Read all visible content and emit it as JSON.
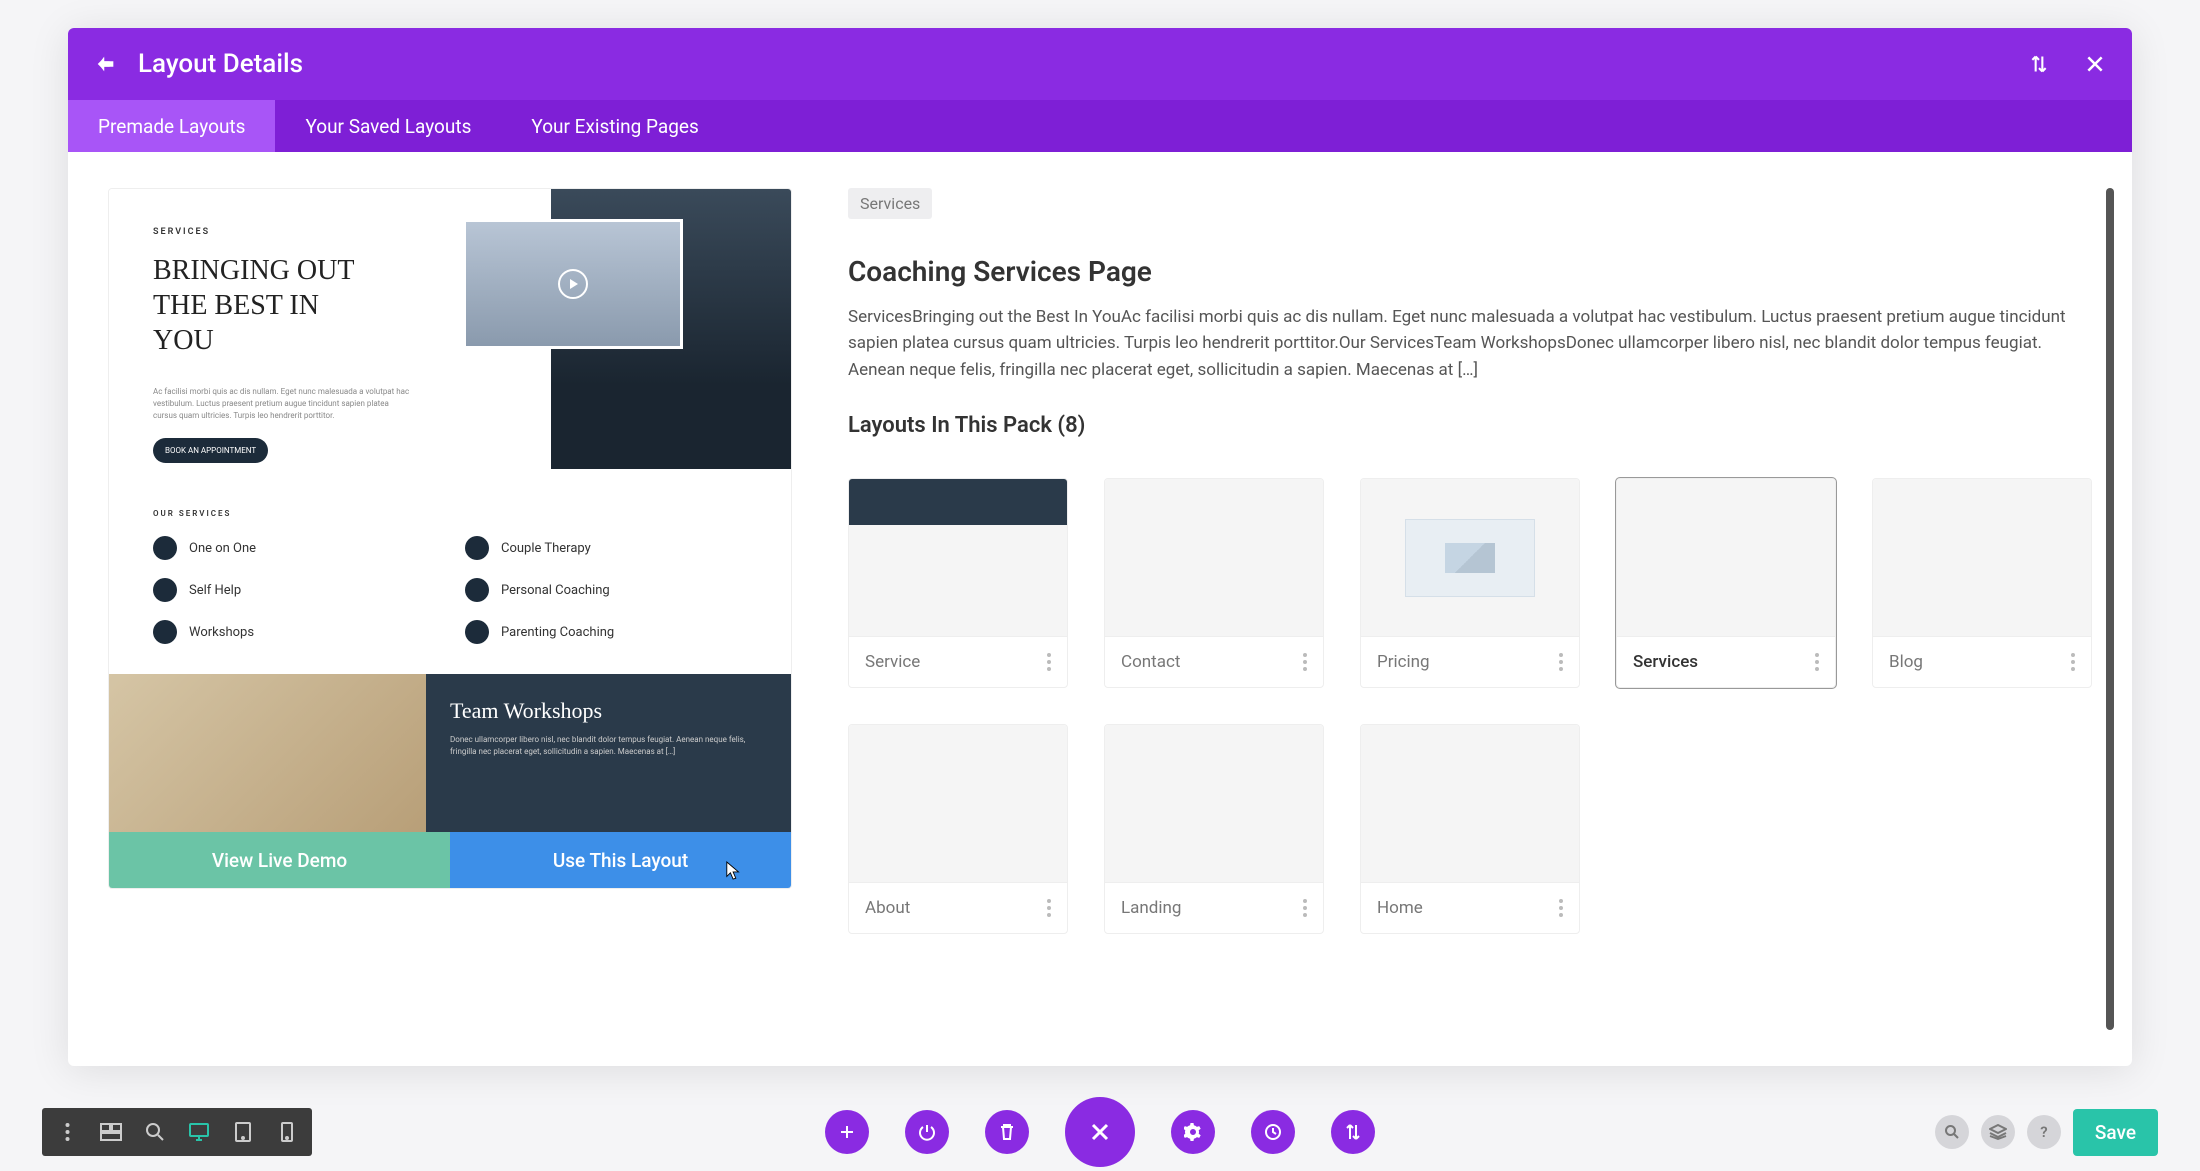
{
  "header": {
    "title": "Layout Details"
  },
  "tabs": [
    {
      "label": "Premade Layouts",
      "active": true
    },
    {
      "label": "Your Saved Layouts",
      "active": false
    },
    {
      "label": "Your Existing Pages",
      "active": false
    }
  ],
  "preview": {
    "hero_tag": "SERVICES",
    "hero_title": "BRINGING OUT THE BEST IN YOU",
    "hero_lorem": "Ac facilisi morbi quis ac dis nullam. Eget nunc malesuada a volutpat hac vestibulum. Luctus praesent pretium augue tincidunt sapien platea cursus quam ultricies. Turpis leo hendrerit porttitor.",
    "hero_button": "BOOK AN APPOINTMENT",
    "services_tag": "OUR SERVICES",
    "services": [
      {
        "label": "One on One"
      },
      {
        "label": "Couple Therapy"
      },
      {
        "label": "Self Help"
      },
      {
        "label": "Personal Coaching"
      },
      {
        "label": "Workshops"
      },
      {
        "label": "Parenting Coaching"
      }
    ],
    "workshops_title": "Team Workshops",
    "workshops_text": "Donec ullamcorper libero nisl, nec blandit dolor tempus feugiat. Aenean neque felis, fringilla nec placerat eget, sollicitudin a sapien. Maecenas at […]",
    "action_demo": "View Live Demo",
    "action_use": "Use This Layout"
  },
  "detail": {
    "badge": "Services",
    "title": "Coaching Services Page",
    "description": "ServicesBringing out the Best In YouAc facilisi morbi quis ac dis nullam. Eget nunc malesuada a volutpat hac vestibulum. Luctus praesent pretium augue tincidunt sapien platea cursus quam ultricies. Turpis leo hendrerit porttitor.Our ServicesTeam WorkshopsDonec ullamcorper libero nisl, nec blandit dolor tempus feugiat. Aenean neque felis, fringilla nec placerat eget, sollicitudin a sapien. Maecenas at […]",
    "pack_title": "Layouts In This Pack (8)",
    "pack": [
      {
        "label": "Service",
        "selected": false
      },
      {
        "label": "Contact",
        "selected": false
      },
      {
        "label": "Pricing",
        "selected": false
      },
      {
        "label": "Services",
        "selected": true
      },
      {
        "label": "Blog",
        "selected": false
      },
      {
        "label": "About",
        "selected": false
      },
      {
        "label": "Landing",
        "selected": false
      },
      {
        "label": "Home",
        "selected": false
      }
    ]
  },
  "bottom": {
    "save": "Save"
  }
}
